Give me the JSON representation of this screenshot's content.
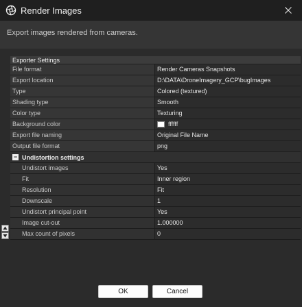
{
  "window": {
    "title": "Render Images",
    "icon": "aperture-icon",
    "close_icon": "close-icon"
  },
  "header": {
    "description": "Export images rendered from cameras."
  },
  "grid": {
    "section_title": "Exporter Settings",
    "rows": [
      {
        "name": "File format",
        "value": "Render Cameras Snapshots"
      },
      {
        "name": "Export location",
        "value": "D:\\DATA\\DroneImagery_GCP\\bugImages"
      },
      {
        "name": "Type",
        "value": "Colored (textured)"
      },
      {
        "name": "Shading type",
        "value": "Smooth"
      },
      {
        "name": "Color type",
        "value": "Texturing"
      },
      {
        "name": "Background color",
        "value": "ffffff",
        "swatch": "#ffffff"
      },
      {
        "name": "Export file naming",
        "value": "Original File Name"
      },
      {
        "name": "Output file format",
        "value": "png"
      }
    ],
    "group": {
      "title": "Undistortion settings",
      "toggle_symbol": "−",
      "rows": [
        {
          "name": "Undistort images",
          "value": "Yes"
        },
        {
          "name": "Fit",
          "value": "Inner region"
        },
        {
          "name": "Resolution",
          "value": "Fit"
        },
        {
          "name": "Downscale",
          "value": "1"
        },
        {
          "name": "Undistort principal point",
          "value": "Yes"
        },
        {
          "name": "Image cut-out",
          "value": "1.000000"
        },
        {
          "name": "Max count of pixels",
          "value": "0"
        }
      ]
    }
  },
  "buttons": {
    "ok": "OK",
    "cancel": "Cancel"
  },
  "colors": {
    "background": "#2b2b2b",
    "titlebar": "#1f1f1f",
    "header_band": "#353535"
  }
}
